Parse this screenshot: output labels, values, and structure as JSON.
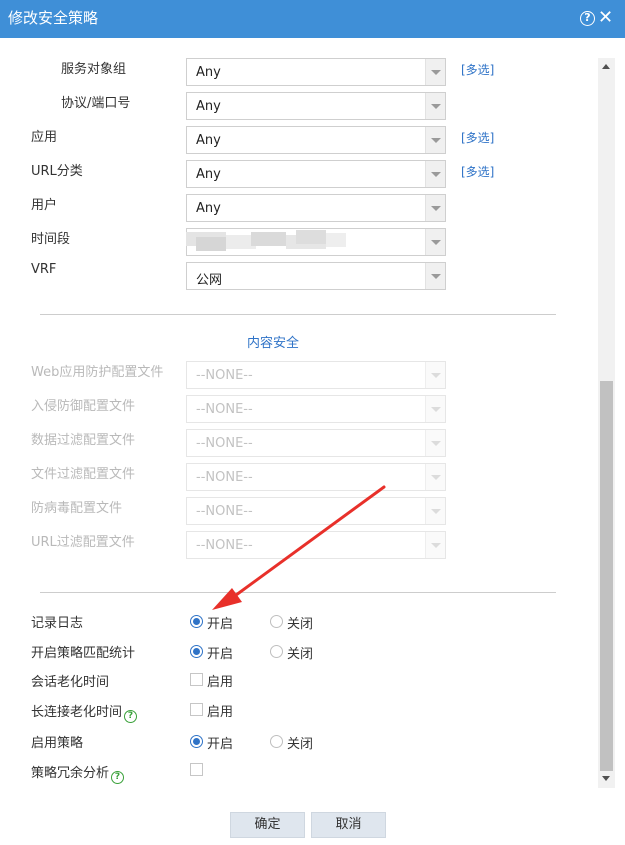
{
  "dialog": {
    "title": "修改安全策略",
    "help_icon": "help-circle-icon",
    "close_icon": "close-icon"
  },
  "match_rows": [
    {
      "label": "服务对象组",
      "value": "Any",
      "link": "[多选]"
    },
    {
      "label": "协议/端口号",
      "value": "Any",
      "link": ""
    },
    {
      "label": "应用",
      "value": "Any",
      "link": "[多选]"
    },
    {
      "label": "URL分类",
      "value": "Any",
      "link": "[多选]"
    },
    {
      "label": "用户",
      "value": "Any",
      "link": ""
    },
    {
      "label": "时间段",
      "value": "",
      "link": ""
    },
    {
      "label": "VRF",
      "value": "公网",
      "link": ""
    }
  ],
  "content_security": {
    "heading": "内容安全",
    "rows": [
      {
        "label": "Web应用防护配置文件",
        "value": "--NONE--"
      },
      {
        "label": "入侵防御配置文件",
        "value": "--NONE--"
      },
      {
        "label": "数据过滤配置文件",
        "value": "--NONE--"
      },
      {
        "label": "文件过滤配置文件",
        "value": "--NONE--"
      },
      {
        "label": "防病毒配置文件",
        "value": "--NONE--"
      },
      {
        "label": "URL过滤配置文件",
        "value": "--NONE--"
      }
    ]
  },
  "options": {
    "log": {
      "label": "记录日志",
      "on": "开启",
      "off": "关闭",
      "selected": "on"
    },
    "match_stats": {
      "label": "开启策略匹配统计",
      "on": "开启",
      "off": "关闭",
      "selected": "on"
    },
    "session_aging": {
      "label": "会话老化时间",
      "check_label": "启用",
      "checked": false
    },
    "long_conn_aging": {
      "label": "长连接老化时间",
      "check_label": "启用",
      "checked": false,
      "help_icon": "help-circle-icon"
    },
    "enable_policy": {
      "label": "启用策略",
      "on": "开启",
      "off": "关闭",
      "selected": "on"
    },
    "redundancy": {
      "label": "策略冗余分析",
      "checked": false,
      "help_icon": "help-circle-icon"
    }
  },
  "buttons": {
    "ok": "确定",
    "cancel": "取消"
  },
  "colors": {
    "titlebar": "#3f8fd7",
    "link": "#2f73c7",
    "annotation_arrow": "#e8302a"
  }
}
